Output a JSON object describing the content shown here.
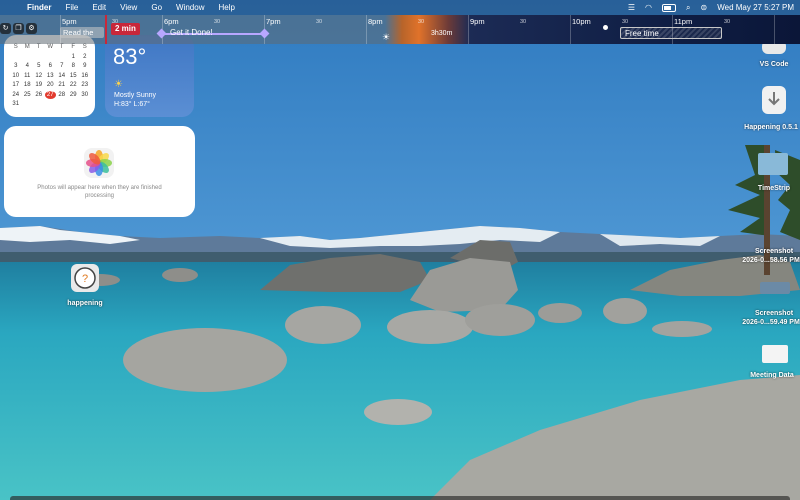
{
  "menubar": {
    "app_name": "Finder",
    "menus": [
      "File",
      "Edit",
      "View",
      "Go",
      "Window",
      "Help"
    ],
    "date_time": "Wed May 27  5:27 PM"
  },
  "timeline": {
    "hours": [
      "5pm",
      "6pm",
      "7pm",
      "8pm",
      "9pm",
      "10pm",
      "11pm"
    ],
    "half_label": "30",
    "now_badge": "2 min",
    "events": {
      "read": "Read the",
      "get_done": "Get it Done!",
      "duration": "3h30m",
      "free": "Free time"
    }
  },
  "calendar": {
    "weekdays": [
      "S",
      "M",
      "T",
      "W",
      "T",
      "F",
      "S"
    ],
    "rows": [
      [
        "",
        "",
        "",
        "",
        "",
        "1",
        "2"
      ],
      [
        "3",
        "4",
        "5",
        "6",
        "7",
        "8",
        "9"
      ],
      [
        "10",
        "11",
        "12",
        "13",
        "14",
        "15",
        "16"
      ],
      [
        "17",
        "18",
        "19",
        "20",
        "21",
        "22",
        "23"
      ],
      [
        "24",
        "25",
        "26",
        "27",
        "28",
        "29",
        "30"
      ],
      [
        "31",
        "",
        "",
        "",
        "",
        "",
        ""
      ]
    ],
    "today": "27"
  },
  "weather": {
    "temp": "83°",
    "condition": "Mostly Sunny",
    "high_low": "H:83° L:67°"
  },
  "photos": {
    "message": "Photos will appear here when they are finished processing"
  },
  "desktop": {
    "happening_app": "happening",
    "vs_code": "VS Code",
    "happening_dmg": "Happening 0.5.1",
    "timestrip": "TimeStrip",
    "screenshot1": [
      "Screenshot",
      "2026-0...58.56 PM"
    ],
    "screenshot2": [
      "Screenshot",
      "2026-0...59.49 PM"
    ],
    "meeting": "Meeting Data"
  },
  "colors": {
    "accent_red": "#c8273a",
    "event_purple": "#b8a7ff",
    "sky": "#3d86c6",
    "water": "#2aa7c0"
  }
}
